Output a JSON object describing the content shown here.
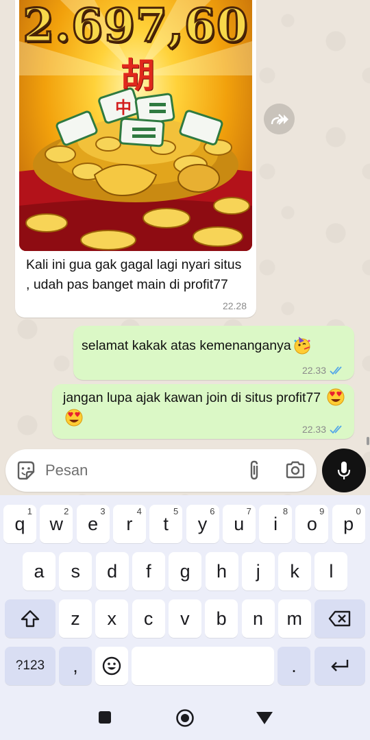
{
  "chat": {
    "incoming": {
      "image": {
        "amount": "2.697,60",
        "character": "胡"
      },
      "text": "Kali ini gua gak gagal lagi nyari situs , udah pas banget main di profit77",
      "time": "22.28"
    },
    "outgoing": [
      {
        "text": "selamat kakak atas kemenanganya",
        "emoji": "party-face",
        "time": "22.33",
        "status": "read"
      },
      {
        "text": "jangan lupa ajak kawan join di situs profit77",
        "emoji": "heart-eyes x2",
        "time": "22.33",
        "status": "read"
      }
    ]
  },
  "input": {
    "placeholder": "Pesan"
  },
  "keyboard": {
    "row1": [
      {
        "key": "q",
        "hint": "1"
      },
      {
        "key": "w",
        "hint": "2"
      },
      {
        "key": "e",
        "hint": "3"
      },
      {
        "key": "r",
        "hint": "4"
      },
      {
        "key": "t",
        "hint": "5"
      },
      {
        "key": "y",
        "hint": "6"
      },
      {
        "key": "u",
        "hint": "7"
      },
      {
        "key": "i",
        "hint": "8"
      },
      {
        "key": "o",
        "hint": "9"
      },
      {
        "key": "p",
        "hint": "0"
      }
    ],
    "row2": [
      "a",
      "s",
      "d",
      "f",
      "g",
      "h",
      "j",
      "k",
      "l"
    ],
    "row3": [
      "z",
      "x",
      "c",
      "v",
      "b",
      "n",
      "m"
    ],
    "symbols_label": "?123",
    "comma": ",",
    "period": "."
  },
  "colors": {
    "outgoing_bubble": "#dbf8c6",
    "incoming_bubble": "#ffffff",
    "read_ticks": "#53a6e8",
    "keyboard_bg": "#eceef9"
  }
}
